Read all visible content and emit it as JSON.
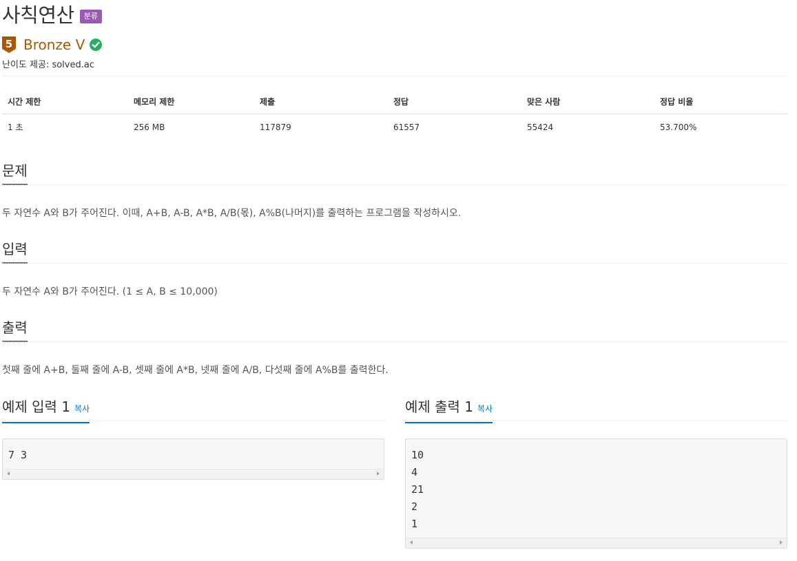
{
  "problem": {
    "title": "사칙연산",
    "category_badge": "분류",
    "tier": "Bronze V",
    "tier_level": "5",
    "tier_color": "#ad5600",
    "solved_check_color": "#2ecc71",
    "provider": "난이도 제공: solved.ac"
  },
  "stats": {
    "headers": [
      "시간 제한",
      "메모리 제한",
      "제출",
      "정답",
      "맞은 사람",
      "정답 비율"
    ],
    "values": [
      "1 초",
      "256 MB",
      "117879",
      "61557",
      "55424",
      "53.700%"
    ]
  },
  "sections": {
    "description": {
      "heading": "문제",
      "text": "두 자연수 A와 B가 주어진다. 이때, A+B, A-B, A*B, A/B(몫), A%B(나머지)를 출력하는 프로그램을 작성하시오."
    },
    "input": {
      "heading": "입력",
      "text": "두 자연수 A와 B가 주어진다. (1 ≤ A, B ≤ 10,000)"
    },
    "output": {
      "heading": "출력",
      "text": "첫째 줄에 A+B, 둘째 줄에 A-B, 셋째 줄에 A*B, 넷째 줄에 A/B, 다섯째 줄에 A%B를 출력한다."
    }
  },
  "samples": {
    "input": {
      "heading": "예제 입력 1",
      "copy_label": "복사",
      "lines": [
        "7 3"
      ]
    },
    "output": {
      "heading": "예제 출력 1",
      "copy_label": "복사",
      "lines": [
        "10",
        "4",
        "21",
        "2",
        "1"
      ]
    }
  }
}
